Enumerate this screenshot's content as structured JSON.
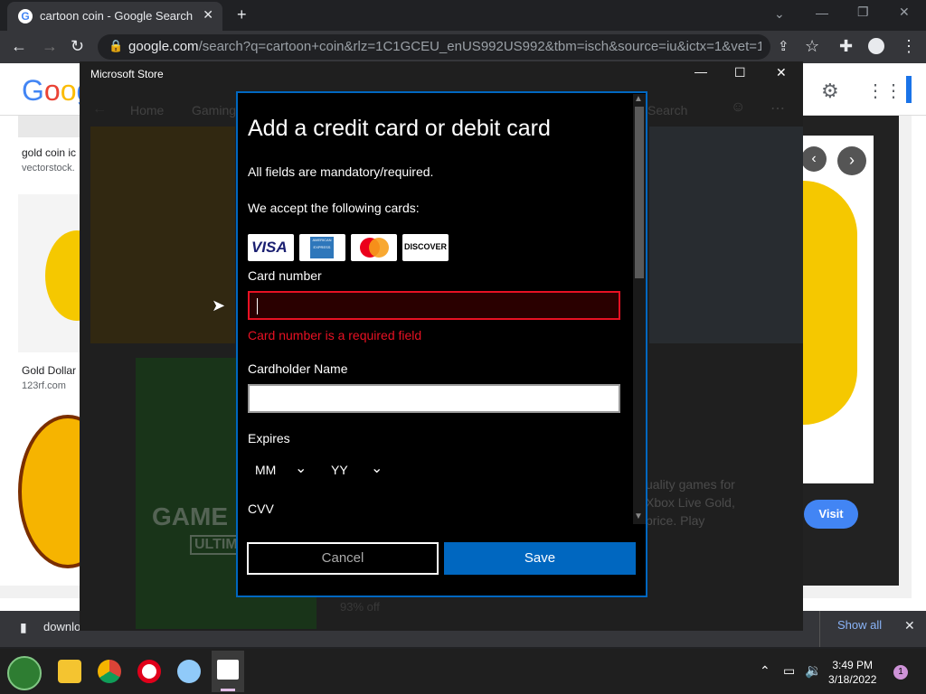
{
  "browser": {
    "tab_title": "cartoon coin - Google Search",
    "url_host": "google.com",
    "url_rest": "/search?q=cartoon+coin&rlz=1C1GCEU_enUS992US992&tbm=isch&source=iu&ictx=1&vet=1&fir=..."
  },
  "google": {
    "logo": "Goog",
    "results": [
      {
        "title": "gold coin ic",
        "source": "vectorstock."
      },
      {
        "title": "Gold Dollar",
        "source": "123rf.com"
      }
    ],
    "visit_label": "Visit",
    "side_text": "uality games for\nXbox Live Gold,\nprice. Play"
  },
  "download_bar": {
    "file": "downlo",
    "show_all": "Show all"
  },
  "store": {
    "window_title": "Microsoft Store",
    "nav": [
      "Home",
      "Gaming"
    ],
    "search_label": "Search",
    "promo_text": "GAME",
    "promo_sub": "ULTIM",
    "discount": "93% off"
  },
  "dialog": {
    "title": "Add a credit card or debit card",
    "mandatory_text": "All fields are mandatory/required.",
    "accept_text": "We accept the following cards:",
    "cards": [
      "VISA",
      "AMERICAN EXPRESS",
      "mastercard",
      "DISCOVER"
    ],
    "card_number_label": "Card number",
    "card_number_value": "",
    "card_number_error": "Card number is a required field",
    "cardholder_label": "Cardholder Name",
    "cardholder_value": "",
    "expires_label": "Expires",
    "month_value": "MM",
    "year_value": "YY",
    "cvv_label": "CVV",
    "cancel_label": "Cancel",
    "save_label": "Save"
  },
  "taskbar": {
    "time": "3:49 PM",
    "date": "3/18/2022",
    "notification_count": "1"
  }
}
